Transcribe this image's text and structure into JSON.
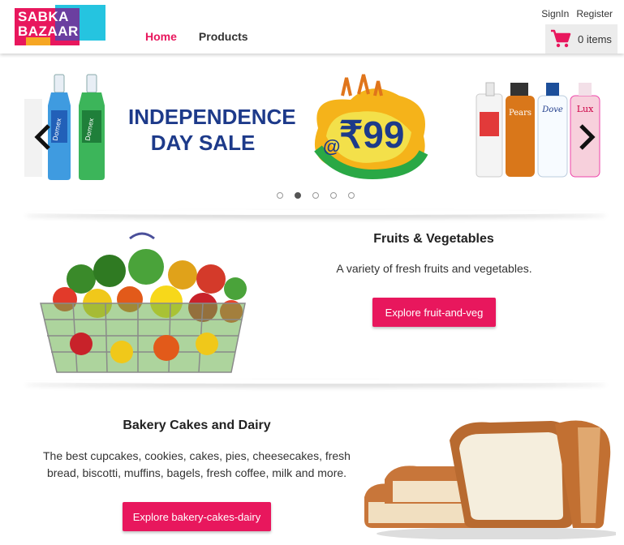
{
  "header": {
    "logo_line1": "SABKA",
    "logo_line2": "BAZAAR",
    "nav": {
      "home": "Home",
      "products": "Products"
    },
    "auth": {
      "signin": "SignIn",
      "register": "Register"
    },
    "cart": {
      "label": "0 items"
    }
  },
  "carousel": {
    "sale_line1": "INDEPENDENCE",
    "sale_line2": "DAY SALE",
    "price_prefix": "@",
    "price": "₹99",
    "product_labels": [
      "Domex",
      "Domex",
      "Pears",
      "Dove",
      "Lux"
    ],
    "dots": 5,
    "active_dot": 1
  },
  "sections": [
    {
      "title": "Fruits & Vegetables",
      "description": "A variety of fresh fruits and vegetables.",
      "button": "Explore fruit-and-veg"
    },
    {
      "title": "Bakery Cakes and Dairy",
      "description_line1": "The best cupcakes, cookies, cakes, pies, cheesecakes, fresh",
      "description_line2": "bread, biscotti, muffins, bagels, fresh coffee, milk and more.",
      "button": "Explore bakery-cakes-dairy"
    }
  ],
  "colors": {
    "accent": "#e8175d",
    "sale_text": "#1d3a8a"
  }
}
